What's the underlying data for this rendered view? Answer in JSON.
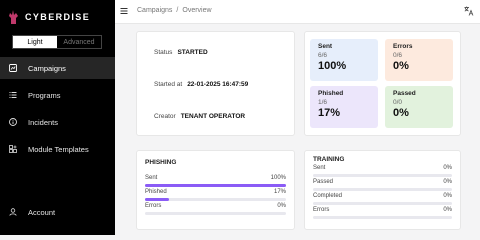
{
  "app": {
    "brand": "CYBERDISE"
  },
  "mode_toggle": {
    "light": "Light",
    "advanced": "Advanced"
  },
  "sidebar": {
    "items": [
      {
        "label": "Campaigns",
        "icon": "campaigns-icon"
      },
      {
        "label": "Programs",
        "icon": "list-icon"
      },
      {
        "label": "Incidents",
        "icon": "info-icon"
      },
      {
        "label": "Module Templates",
        "icon": "module-templates-icon"
      },
      {
        "label": "Account",
        "icon": "user-icon"
      }
    ]
  },
  "breadcrumb": {
    "root": "Campaigns",
    "separator": "/",
    "current": "Overview"
  },
  "details": {
    "status_label": "Status",
    "status_value": "STARTED",
    "started_label": "Started at",
    "started_value": "22-01-2025 16:47:59",
    "creator_label": "Creator",
    "creator_value": "TENANT OPERATOR"
  },
  "stats": {
    "sent": {
      "title": "Sent",
      "fraction": "6/6",
      "percent": "100%",
      "color": "#e6eefb"
    },
    "errors": {
      "title": "Errors",
      "fraction": "0/6",
      "percent": "0%",
      "color": "#fdeade"
    },
    "phished": {
      "title": "Phished",
      "fraction": "1/6",
      "percent": "17%",
      "color": "#ece6fb"
    },
    "passed": {
      "title": "Passed",
      "fraction": "0/0",
      "percent": "0%",
      "color": "#e2f2dd"
    }
  },
  "phishing": {
    "title": "PHISHING",
    "rows": [
      {
        "label": "Sent",
        "value": "100%",
        "fraction": 1.0
      },
      {
        "label": "Phished",
        "value": "17%",
        "fraction": 0.17
      },
      {
        "label": "Errors",
        "value": "0%",
        "fraction": 0.0
      }
    ]
  },
  "training": {
    "title": "TRAINING",
    "rows": [
      {
        "label": "Sent",
        "value": "0%",
        "fraction": 0.0
      },
      {
        "label": "Passed",
        "value": "0%",
        "fraction": 0.0
      },
      {
        "label": "Completed",
        "value": "0%",
        "fraction": 0.0
      },
      {
        "label": "Errors",
        "value": "0%",
        "fraction": 0.0
      }
    ]
  },
  "colors": {
    "sidebar_bg": "#000000",
    "accent": "#8b5cf6",
    "logo": "#c0396b"
  }
}
